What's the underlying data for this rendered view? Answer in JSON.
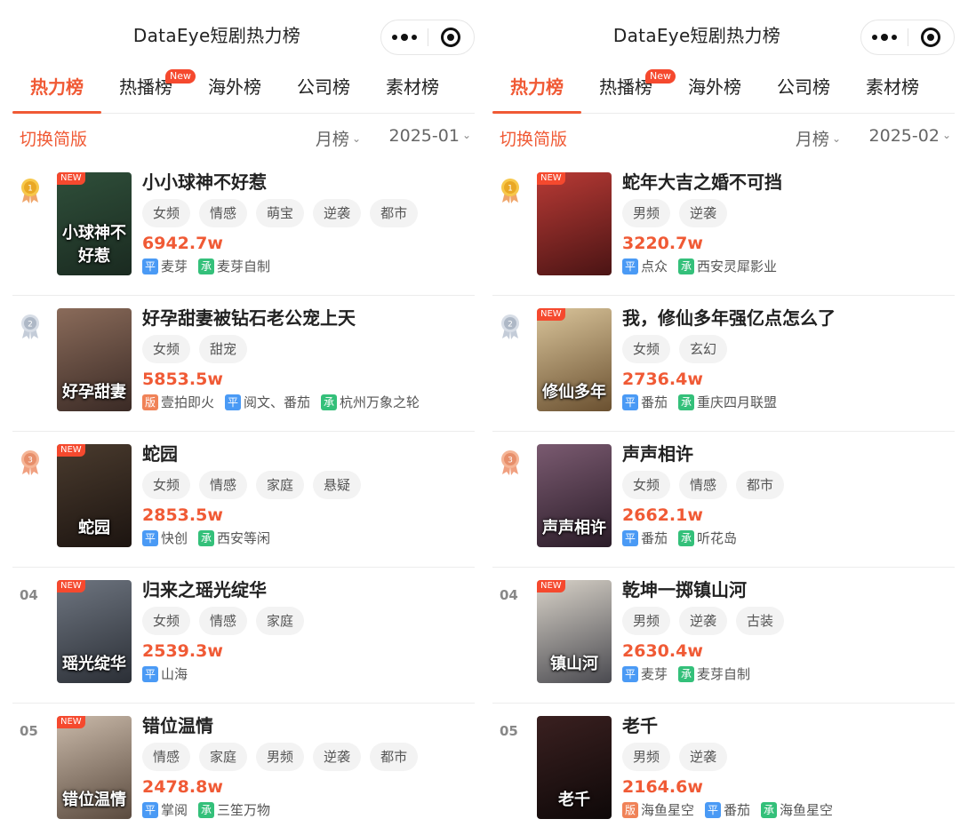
{
  "colors": {
    "accent": "#f05a35",
    "tag_bg": "#f3f3f3",
    "ping": "#4a9af5",
    "cheng": "#34c07a",
    "ban": "#f08257"
  },
  "panels": [
    {
      "app_title": "DataEye短剧热力榜",
      "tabs": [
        {
          "label": "热力榜",
          "active": true
        },
        {
          "label": "热播榜",
          "badge": "New"
        },
        {
          "label": "海外榜"
        },
        {
          "label": "公司榜"
        },
        {
          "label": "素材榜"
        }
      ],
      "switch_simple": "切换简版",
      "period": "月榜",
      "date": "2025-01",
      "items": [
        {
          "rank": "1",
          "rank_icon": "gold-medal-icon",
          "title": "小小球神不好惹",
          "tags": [
            "女频",
            "情感",
            "萌宝",
            "逆袭",
            "都市"
          ],
          "heat": "6942.7w",
          "new": "NEW",
          "caption": "小球神不好惹",
          "meta": [
            {
              "badge": "平",
              "type": "ping",
              "text": "麦芽"
            },
            {
              "badge": "承",
              "type": "cheng",
              "text": "麦芽自制"
            }
          ]
        },
        {
          "rank": "2",
          "rank_icon": "silver-medal-icon",
          "title": "好孕甜妻被钻石老公宠上天",
          "tags": [
            "女频",
            "甜宠"
          ],
          "heat": "5853.5w",
          "new": "",
          "caption": "好孕甜妻",
          "meta": [
            {
              "badge": "版",
              "type": "ban",
              "text": "壹拍即火"
            },
            {
              "badge": "平",
              "type": "ping",
              "text": "阅文、番茄"
            },
            {
              "badge": "承",
              "type": "cheng",
              "text": "杭州万象之轮"
            }
          ]
        },
        {
          "rank": "3",
          "rank_icon": "bronze-medal-icon",
          "title": "蛇园",
          "tags": [
            "女频",
            "情感",
            "家庭",
            "悬疑"
          ],
          "heat": "2853.5w",
          "new": "NEW",
          "caption": "蛇园",
          "meta": [
            {
              "badge": "平",
              "type": "ping",
              "text": "快创"
            },
            {
              "badge": "承",
              "type": "cheng",
              "text": "西安等闲"
            }
          ]
        },
        {
          "rank": "04",
          "rank_icon": "",
          "title": "归来之瑶光绽华",
          "tags": [
            "女频",
            "情感",
            "家庭"
          ],
          "heat": "2539.3w",
          "new": "NEW",
          "caption": "瑶光绽华",
          "meta": [
            {
              "badge": "平",
              "type": "ping",
              "text": "山海"
            }
          ]
        },
        {
          "rank": "05",
          "rank_icon": "",
          "title": "错位温情",
          "tags": [
            "情感",
            "家庭",
            "男频",
            "逆袭",
            "都市"
          ],
          "heat": "2478.8w",
          "new": "NEW",
          "caption": "错位温情",
          "meta": [
            {
              "badge": "平",
              "type": "ping",
              "text": "掌阅"
            },
            {
              "badge": "承",
              "type": "cheng",
              "text": "三笙万物"
            }
          ]
        }
      ]
    },
    {
      "app_title": "DataEye短剧热力榜",
      "tabs": [
        {
          "label": "热力榜",
          "active": true
        },
        {
          "label": "热播榜",
          "badge": "New"
        },
        {
          "label": "海外榜"
        },
        {
          "label": "公司榜"
        },
        {
          "label": "素材榜"
        }
      ],
      "switch_simple": "切换简版",
      "period": "月榜",
      "date": "2025-02",
      "items": [
        {
          "rank": "1",
          "rank_icon": "gold-medal-icon",
          "title": "蛇年大吉之婚不可挡",
          "tags": [
            "男频",
            "逆袭"
          ],
          "heat": "3220.7w",
          "new": "NEW",
          "caption": "",
          "meta": [
            {
              "badge": "平",
              "type": "ping",
              "text": "点众"
            },
            {
              "badge": "承",
              "type": "cheng",
              "text": "西安灵犀影业"
            }
          ]
        },
        {
          "rank": "2",
          "rank_icon": "silver-medal-icon",
          "title": "我，修仙多年强亿点怎么了",
          "tags": [
            "女频",
            "玄幻"
          ],
          "heat": "2736.4w",
          "new": "NEW",
          "caption": "修仙多年",
          "meta": [
            {
              "badge": "平",
              "type": "ping",
              "text": "番茄"
            },
            {
              "badge": "承",
              "type": "cheng",
              "text": "重庆四月联盟"
            }
          ]
        },
        {
          "rank": "3",
          "rank_icon": "bronze-medal-icon",
          "title": "声声相许",
          "tags": [
            "女频",
            "情感",
            "都市"
          ],
          "heat": "2662.1w",
          "new": "",
          "caption": "声声相许",
          "meta": [
            {
              "badge": "平",
              "type": "ping",
              "text": "番茄"
            },
            {
              "badge": "承",
              "type": "cheng",
              "text": "听花岛"
            }
          ]
        },
        {
          "rank": "04",
          "rank_icon": "",
          "title": "乾坤一掷镇山河",
          "tags": [
            "男频",
            "逆袭",
            "古装"
          ],
          "heat": "2630.4w",
          "new": "NEW",
          "caption": "镇山河",
          "meta": [
            {
              "badge": "平",
              "type": "ping",
              "text": "麦芽"
            },
            {
              "badge": "承",
              "type": "cheng",
              "text": "麦芽自制"
            }
          ]
        },
        {
          "rank": "05",
          "rank_icon": "",
          "title": "老千",
          "tags": [
            "男频",
            "逆袭"
          ],
          "heat": "2164.6w",
          "new": "",
          "caption": "老千",
          "meta": [
            {
              "badge": "版",
              "type": "ban",
              "text": "海鱼星空"
            },
            {
              "badge": "平",
              "type": "ping",
              "text": "番茄"
            },
            {
              "badge": "承",
              "type": "cheng",
              "text": "海鱼星空"
            }
          ]
        }
      ]
    }
  ]
}
